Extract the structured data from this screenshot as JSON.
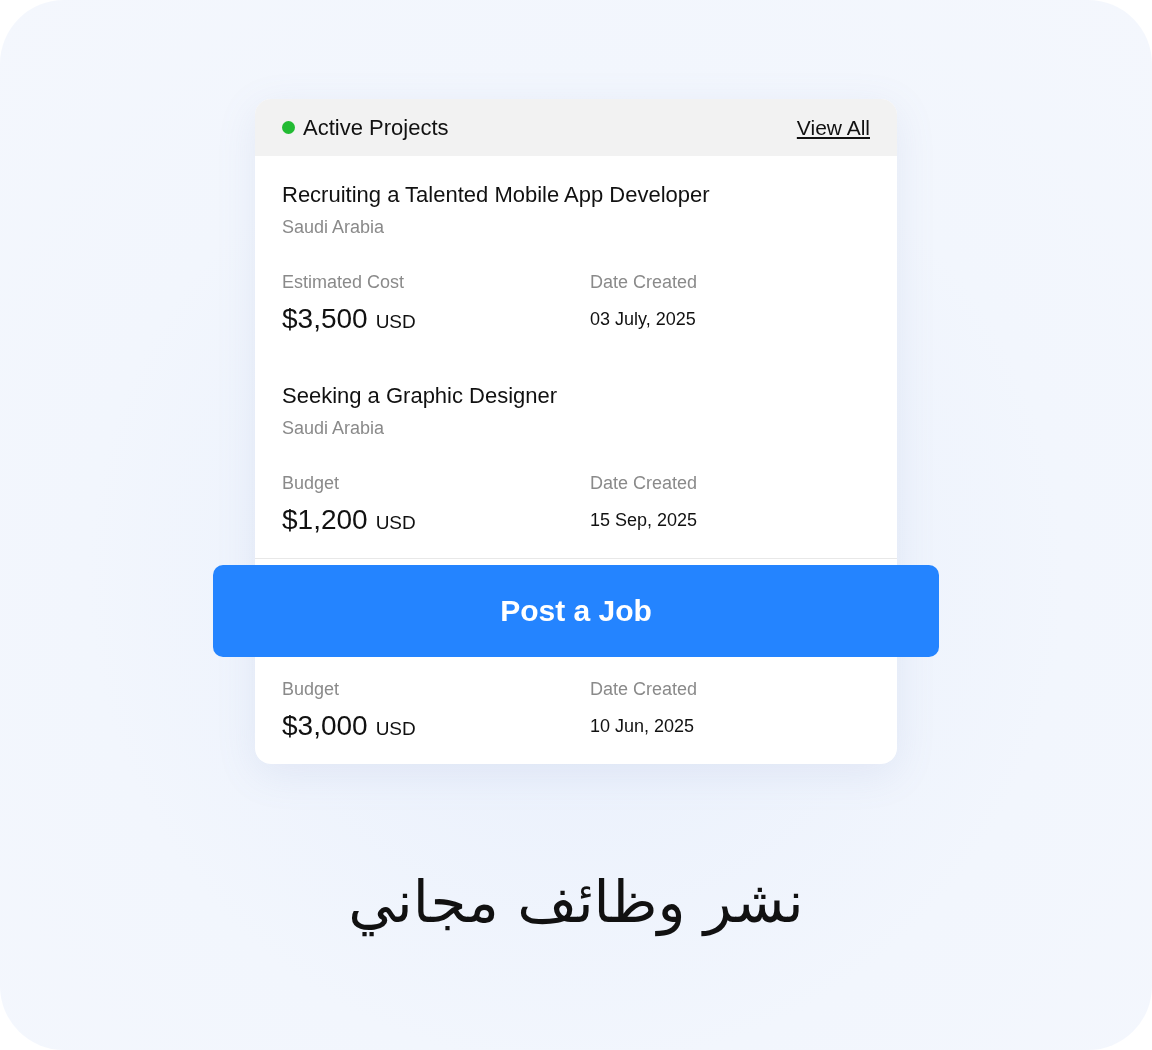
{
  "card": {
    "title": "Active Projects",
    "active": true,
    "view_all": "View All"
  },
  "projects": [
    {
      "title": "Recruiting a Talented Mobile App Developer",
      "location": "Saudi Arabia",
      "amount_label": "Estimated Cost",
      "amount": "$3,500",
      "currency": "USD",
      "date_label": "Date Created",
      "date": "03 July, 2025"
    },
    {
      "title": "Seeking a Graphic Designer",
      "location": "Saudi Arabia",
      "amount_label": "Budget",
      "amount": "$1,200",
      "currency": "USD",
      "date_label": "Date Created",
      "date": "15 Sep, 2025"
    },
    {
      "amount_label": "Budget",
      "amount": "$3,000",
      "currency": "USD",
      "date_label": "Date Created",
      "date": "10 Jun, 2025"
    }
  ],
  "post_button": "Post a Job",
  "caption": "نشر وظائف مجاني"
}
